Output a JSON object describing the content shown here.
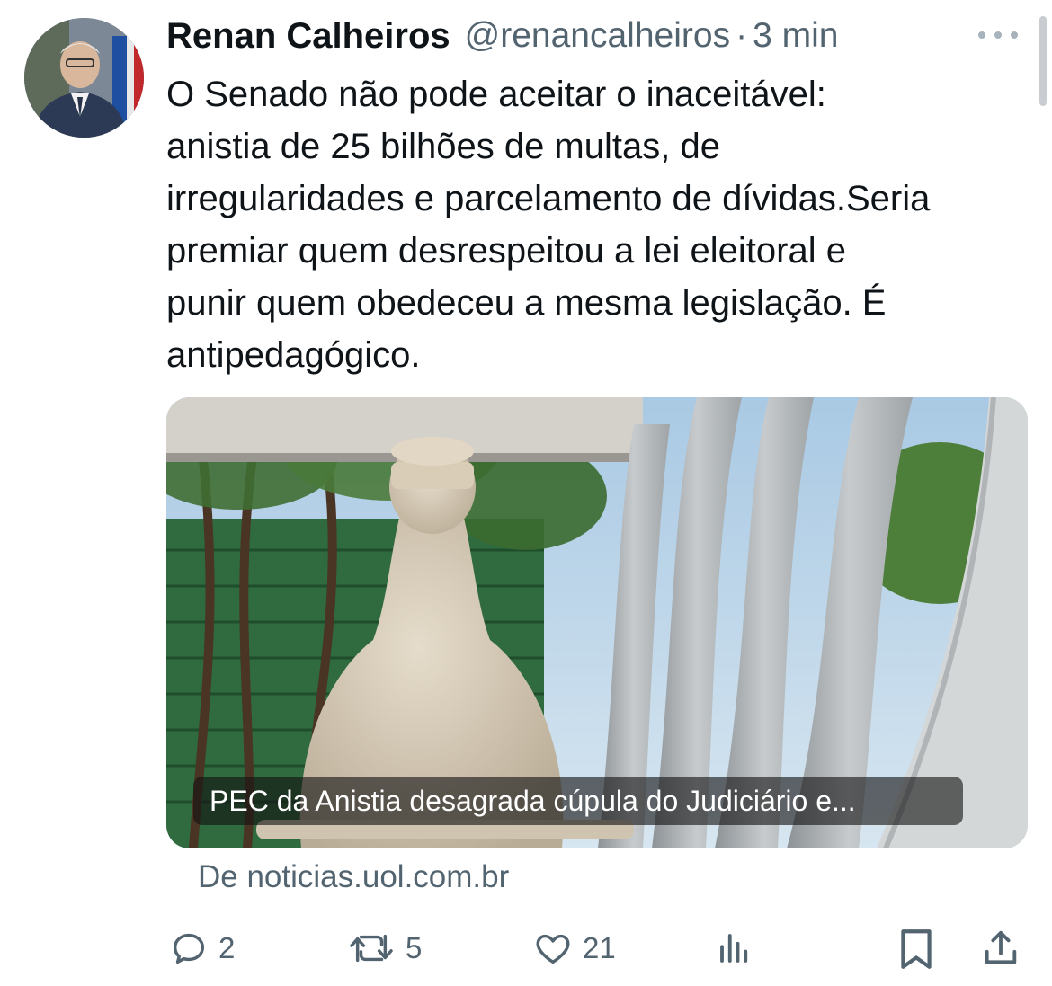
{
  "author": {
    "name": "Renan Calheiros",
    "handle": "@renancalheiros",
    "separator": "·",
    "time": "3 min"
  },
  "tweet": {
    "text": "O Senado não pode aceitar o inaceitável:\nanistia de 25 bilhões de multas, de\nirregularidades e parcelamento de dívidas.Seria\npremiar quem desrespeitou a lei eleitoral e\npunir quem obedeceu a mesma legislação. É\nantipedagógico."
  },
  "link_card": {
    "caption": "PEC da Anistia desagrada cúpula do Judiciário e...",
    "source": "De noticias.uol.com.br"
  },
  "actions": {
    "replies": "2",
    "retweets": "5",
    "likes": "21"
  },
  "icons": {
    "more": "more-icon",
    "reply": "reply-icon",
    "retweet": "retweet-icon",
    "like": "heart-icon",
    "views": "views-icon",
    "bookmark": "bookmark-icon",
    "share": "share-icon"
  },
  "colors": {
    "text": "#0f1419",
    "secondary": "#536471",
    "background": "#ffffff"
  }
}
